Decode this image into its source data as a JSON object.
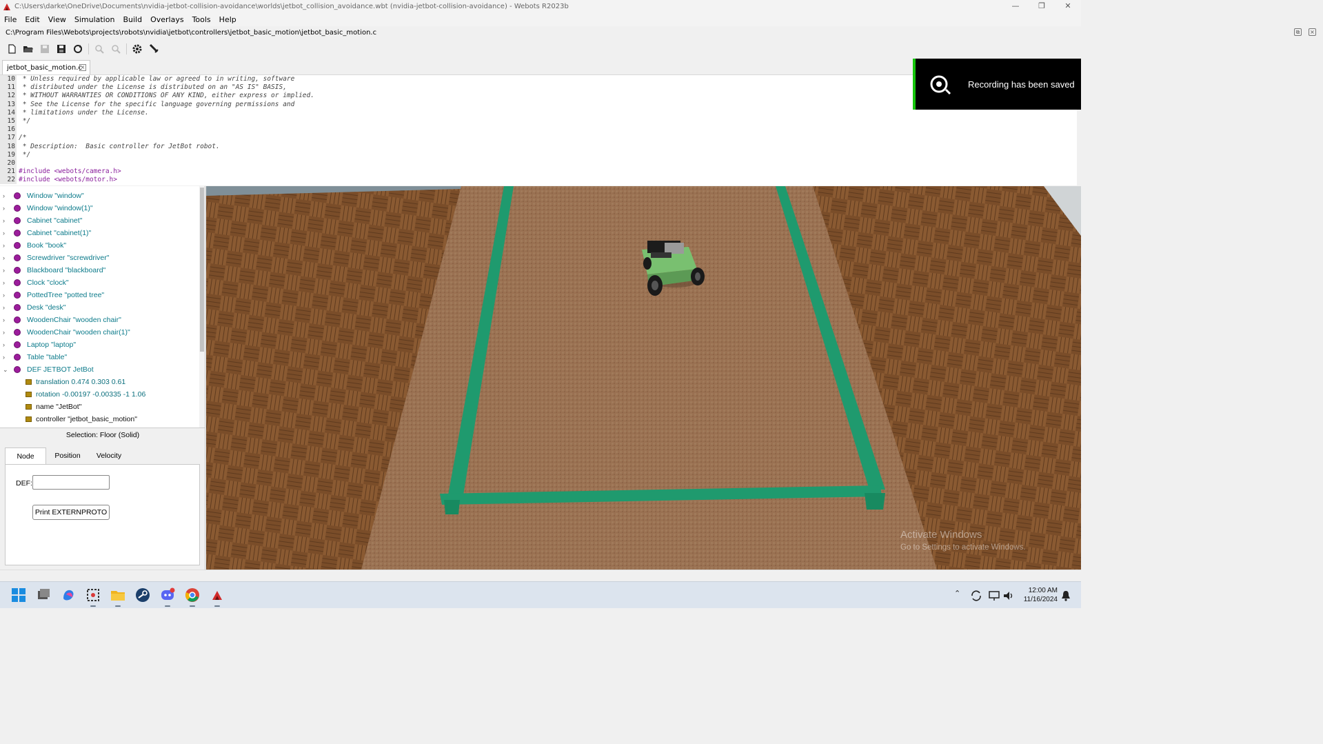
{
  "window": {
    "title": "C:\\Users\\darke\\OneDrive\\Documents\\nvidia-jetbot-collision-avoidance\\worlds\\jetbot_collision_avoidance.wbt (nvidia-jetbot-collision-avoidance) - Webots R2023b",
    "controls": [
      "—",
      "❐",
      "✕"
    ]
  },
  "menu": [
    "File",
    "Edit",
    "View",
    "Simulation",
    "Build",
    "Overlays",
    "Tools",
    "Help"
  ],
  "editor": {
    "file_path": "C:\\Program Files\\Webots\\projects\\robots\\nvidia\\jetbot\\controllers\\jetbot_basic_motion\\jetbot_basic_motion.c",
    "tab_label": "jetbot_basic_motion.c",
    "lines": [
      {
        "n": "10",
        "text": " * Unless required by applicable law or agreed to in writing, software",
        "kind": "comment"
      },
      {
        "n": "11",
        "text": " * distributed under the License is distributed on an \"AS IS\" BASIS,",
        "kind": "comment"
      },
      {
        "n": "12",
        "text": " * WITHOUT WARRANTIES OR CONDITIONS OF ANY KIND, either express or implied.",
        "kind": "comment"
      },
      {
        "n": "13",
        "text": " * See the License for the specific language governing permissions and",
        "kind": "comment"
      },
      {
        "n": "14",
        "text": " * limitations under the License.",
        "kind": "comment"
      },
      {
        "n": "15",
        "text": " */",
        "kind": "comment"
      },
      {
        "n": "16",
        "text": "",
        "kind": "comment"
      },
      {
        "n": "17",
        "text": "/*",
        "kind": "comment"
      },
      {
        "n": "18",
        "text": " * Description:  Basic controller for JetBot robot.",
        "kind": "comment"
      },
      {
        "n": "19",
        "text": " */",
        "kind": "comment"
      },
      {
        "n": "20",
        "text": "",
        "kind": "comment"
      },
      {
        "n": "21",
        "text": "#include <webots/camera.h>",
        "kind": "pp"
      },
      {
        "n": "22",
        "text": "#include <webots/motor.h>",
        "kind": "pp"
      }
    ]
  },
  "notification": {
    "text": "Recording has been saved",
    "accent": "#16c60c"
  },
  "scene_tree": {
    "nodes": [
      {
        "label": "Window \"window\"",
        "type": "node",
        "expander": "›"
      },
      {
        "label": "Window \"window(1)\"",
        "type": "node",
        "expander": "›"
      },
      {
        "label": "Cabinet \"cabinet\"",
        "type": "node",
        "expander": "›"
      },
      {
        "label": "Cabinet \"cabinet(1)\"",
        "type": "node",
        "expander": "›"
      },
      {
        "label": "Book \"book\"",
        "type": "node",
        "expander": "›"
      },
      {
        "label": "Screwdriver \"screwdriver\"",
        "type": "node",
        "expander": "›"
      },
      {
        "label": "Blackboard \"blackboard\"",
        "type": "node",
        "expander": "›"
      },
      {
        "label": "Clock \"clock\"",
        "type": "node",
        "expander": "›"
      },
      {
        "label": "PottedTree \"potted tree\"",
        "type": "node",
        "expander": "›"
      },
      {
        "label": "Desk \"desk\"",
        "type": "node",
        "expander": "›"
      },
      {
        "label": "WoodenChair \"wooden chair\"",
        "type": "node",
        "expander": "›"
      },
      {
        "label": "WoodenChair \"wooden chair(1)\"",
        "type": "node",
        "expander": "›"
      },
      {
        "label": "Laptop \"laptop\"",
        "type": "node",
        "expander": "›"
      },
      {
        "label": "Table \"table\"",
        "type": "node",
        "expander": "›"
      },
      {
        "label": "DEF JETBOT JetBot",
        "type": "node",
        "expander": "⌄"
      },
      {
        "label": "translation 0.474 0.303 0.61",
        "type": "field",
        "plain": false
      },
      {
        "label": "rotation -0.00197 -0.00335 -1 1.06",
        "type": "field",
        "plain": false
      },
      {
        "label": "name \"JetBot\"",
        "type": "field",
        "plain": true
      },
      {
        "label": "controller \"jetbot_basic_motion\"",
        "type": "field",
        "plain": true
      }
    ]
  },
  "field_editor": {
    "selection": "Selection: Floor (Solid)",
    "tabs": [
      "Node",
      "Position",
      "Velocity"
    ],
    "active_tab": "Node",
    "def_label": "DEF:",
    "def_value": "",
    "print_button": "Print EXTERNPROTO"
  },
  "viewport": {
    "watermark_title": "Activate Windows",
    "watermark_sub": "Go to Settings to activate Windows."
  },
  "taskbar": {
    "time": "12:00 AM",
    "date": "11/16/2024"
  },
  "colors": {
    "tape": "#1f9a6e",
    "node_dot": "#9c1d9c",
    "field_square": "#b08a10",
    "node_text": "#0b7a8a"
  }
}
